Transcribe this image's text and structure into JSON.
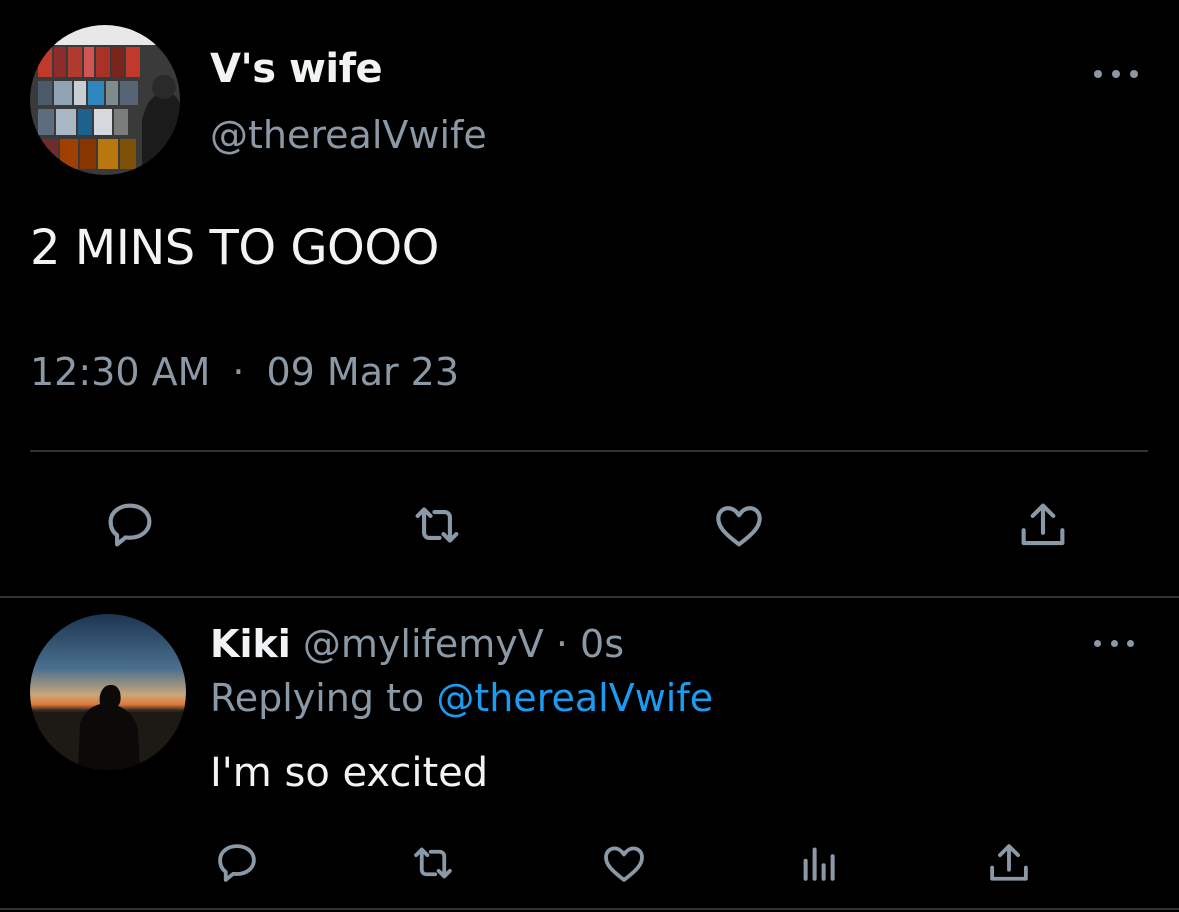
{
  "main_tweet": {
    "display_name": "V's wife",
    "handle": "@therealVwife",
    "text": "2 MINS TO GOOO",
    "time": "12:30 AM",
    "separator": "·",
    "date": "09 Mar 23"
  },
  "reply": {
    "display_name": "Kiki",
    "handle": "@mylifemyV",
    "separator": "·",
    "age": "0s",
    "replying_prefix": "Replying to",
    "replying_mention": "@therealVwife",
    "text": "I'm so excited"
  },
  "colors": {
    "background": "#000000",
    "text_primary": "#f1f3f4",
    "text_secondary": "#8b98a5",
    "accent": "#1d9bf0",
    "divider": "#2f3336"
  },
  "icons": {
    "reply": "speech-bubble-icon",
    "retweet": "retweet-icon",
    "like": "heart-icon",
    "share": "share-icon",
    "analytics": "bar-chart-icon",
    "more": "more-dots-icon"
  }
}
